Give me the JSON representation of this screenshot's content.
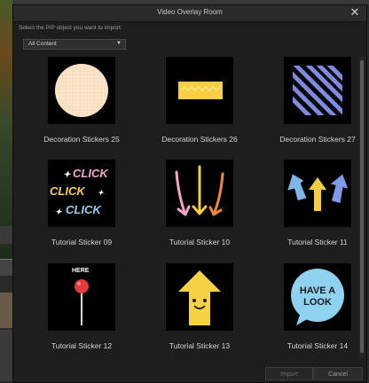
{
  "dialog": {
    "title": "Video Overlay Room",
    "close_label": "✕",
    "instruction": "Select the PiP object you want to import:",
    "filter": {
      "selected": "All Content"
    }
  },
  "stickers": [
    {
      "label": "Decoration Stickers 25",
      "icon": "peach-grid-circle-sticker"
    },
    {
      "label": "Decoration Stickers 26",
      "icon": "yellow-zigzag-band-sticker"
    },
    {
      "label": "Decoration Stickers 27",
      "icon": "blue-diagonal-stripes-sticker"
    },
    {
      "label": "Tutorial Sticker 09",
      "icon": "click-click-click-sticker",
      "text_lines": [
        "CLICK",
        "CLICK",
        "CLICK"
      ]
    },
    {
      "label": "Tutorial Sticker 10",
      "icon": "three-down-arrows-sticker"
    },
    {
      "label": "Tutorial Sticker 11",
      "icon": "three-up-arrows-sticker"
    },
    {
      "label": "Tutorial Sticker 12",
      "icon": "red-pin-here-sticker",
      "pin_text": "HERE"
    },
    {
      "label": "Tutorial Sticker 13",
      "icon": "smiling-yellow-arrow-sticker"
    },
    {
      "label": "Tutorial Sticker 14",
      "icon": "have-a-look-bubble-sticker",
      "bubble_lines": [
        "HAVE A",
        "LOOK"
      ]
    }
  ],
  "footer": {
    "import_label": "Import",
    "cancel_label": "Cancel"
  }
}
